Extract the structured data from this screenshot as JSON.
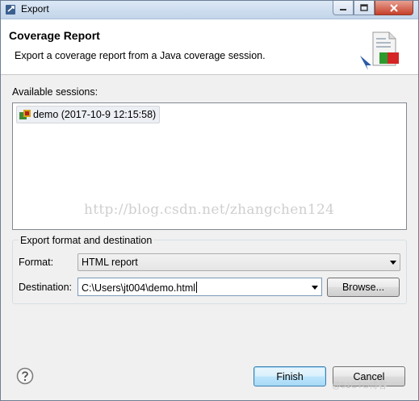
{
  "window": {
    "title": "Export",
    "icon": "eclipse-export-icon",
    "controls": [
      "minimize-icon",
      "maximize-icon",
      "close-icon"
    ]
  },
  "header": {
    "title": "Coverage Report",
    "message": "Export a coverage report from a Java coverage session.",
    "banner_icon": "coverage-report-banner-icon"
  },
  "sessions": {
    "label": "Available sessions:",
    "items": [
      {
        "label": "demo (2017-10-9 12:15:58)",
        "icon": "coverage-session-icon",
        "selected": true
      }
    ]
  },
  "watermark": "http://blog.csdn.net/zhangchen124",
  "export_group": {
    "legend": "Export format and destination",
    "format_label": "Format:",
    "format_value": "HTML report",
    "destination_label": "Destination:",
    "destination_value": "C:\\Users\\jt004\\demo.html",
    "browse_label": "Browse..."
  },
  "footer": {
    "help_icon": "help-icon",
    "finish_label": "Finish",
    "cancel_label": "Cancel",
    "site_mark": "@51CTO博客"
  },
  "colors": {
    "accent_default_button": "#3c7fb1",
    "title_bar": "#c3d5ea",
    "close_button": "#c6402a"
  }
}
